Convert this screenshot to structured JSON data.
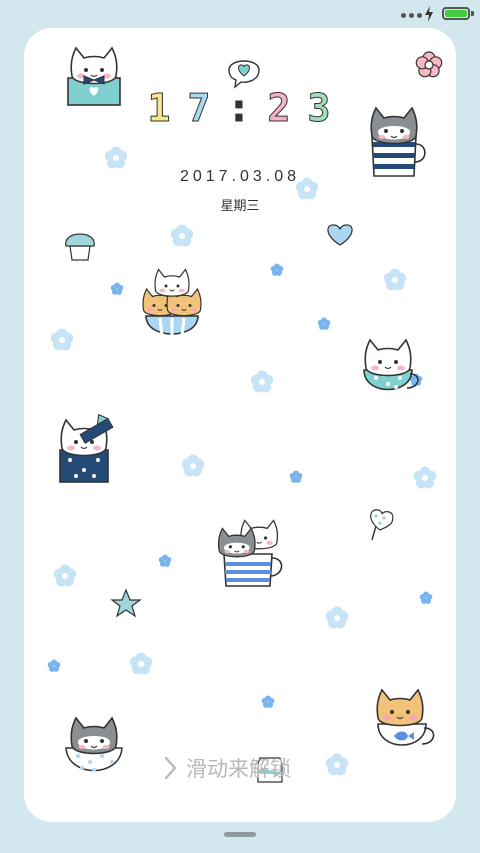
{
  "status_bar": {
    "battery_level": 1.0,
    "battery_color": "#44cc3e",
    "icons": [
      "signal-dots-icon",
      "charging-icon",
      "battery-icon"
    ]
  },
  "lock_screen": {
    "time": {
      "h1": "1",
      "h2": "7",
      "colon": ":",
      "m1": "2",
      "m2": "3"
    },
    "date": "2017.03.08",
    "weekday": "星期三",
    "unlock_hint": "滑动来解锁"
  },
  "theme_colors": {
    "background": "#d3e7ee",
    "flower": "#c6e4f6",
    "flower_dark": "#7ab4ee",
    "teal": "#7fd0cf",
    "navy": "#244a78"
  }
}
